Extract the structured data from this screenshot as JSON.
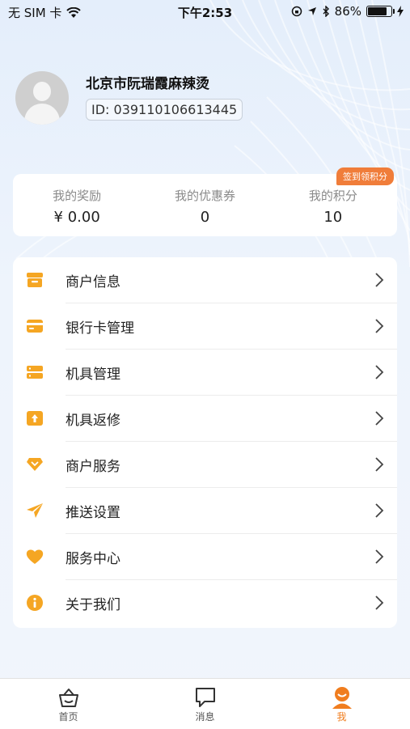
{
  "status_bar": {
    "carrier": "无 SIM 卡",
    "time": "下午2:53",
    "battery_percent": "86%",
    "battery_level": 0.86
  },
  "profile": {
    "shop_name": "北京市阮瑞霞麻辣烫",
    "id_text": "ID: 039110106613445"
  },
  "stats": {
    "checkin_badge": "签到领积分",
    "items": [
      {
        "label": "我的奖励",
        "value": "¥ 0.00"
      },
      {
        "label": "我的优惠券",
        "value": "0"
      },
      {
        "label": "我的积分",
        "value": "10"
      }
    ]
  },
  "menu": {
    "items": [
      {
        "label": "商户信息",
        "icon": "store-icon"
      },
      {
        "label": "银行卡管理",
        "icon": "bank-card-icon"
      },
      {
        "label": "机具管理",
        "icon": "device-icon"
      },
      {
        "label": "机具返修",
        "icon": "repair-box-icon"
      },
      {
        "label": "商户服务",
        "icon": "diamond-icon"
      },
      {
        "label": "推送设置",
        "icon": "paper-plane-icon"
      },
      {
        "label": "服务中心",
        "icon": "heart-icon"
      },
      {
        "label": "关于我们",
        "icon": "info-icon"
      }
    ]
  },
  "tabs": [
    {
      "label": "首页",
      "icon": "home-basket-icon"
    },
    {
      "label": "消息",
      "icon": "message-icon"
    },
    {
      "label": "我",
      "icon": "user-icon",
      "active": true
    }
  ],
  "colors": {
    "accent": "#f5a623",
    "badge": "#f07d3a",
    "active_tab": "#f07d1e"
  }
}
